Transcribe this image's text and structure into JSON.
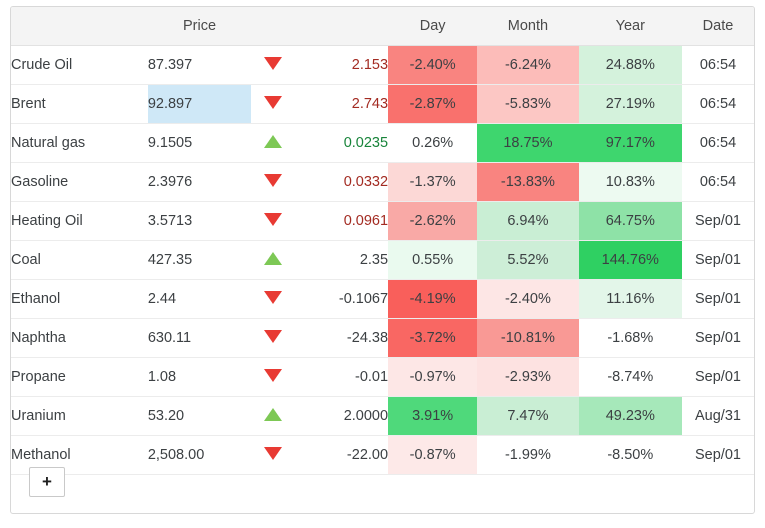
{
  "table": {
    "headers": {
      "name": "",
      "price": "Price",
      "arrow": "",
      "change": "",
      "day": "Day",
      "month": "Month",
      "year": "Year",
      "date": "Date"
    },
    "rows": [
      {
        "name": "Crude Oil",
        "price": "87.397",
        "direction": "down",
        "change": "2.153",
        "change_tone": "down",
        "day": "-2.40%",
        "day_bg": "#f98480",
        "month": "-6.24%",
        "month_bg": "#fcbcb9",
        "year": "24.88%",
        "year_bg": "#d4f2dc",
        "date": "06:54",
        "price_selected": false
      },
      {
        "name": "Brent",
        "price": "92.897",
        "direction": "down",
        "change": "2.743",
        "change_tone": "down",
        "day": "-2.87%",
        "day_bg": "#f9716d",
        "month": "-5.83%",
        "month_bg": "#fcc7c4",
        "year": "27.19%",
        "year_bg": "#d4f2dc",
        "date": "06:54",
        "price_selected": true
      },
      {
        "name": "Natural gas",
        "price": "9.1505",
        "direction": "up",
        "change": "0.0235",
        "change_tone": "up",
        "day": "0.26%",
        "day_bg": "#ffffff",
        "month": "18.75%",
        "month_bg": "#3ed66e",
        "year": "97.17%",
        "year_bg": "#3ed66e",
        "date": "06:54",
        "price_selected": false
      },
      {
        "name": "Gasoline",
        "price": "2.3976",
        "direction": "down",
        "change": "0.0332",
        "change_tone": "down",
        "day": "-1.37%",
        "day_bg": "#fcd8d6",
        "month": "-13.83%",
        "month_bg": "#f98480",
        "year": "10.83%",
        "year_bg": "#edfaf1",
        "date": "06:54",
        "price_selected": false
      },
      {
        "name": "Heating Oil",
        "price": "3.5713",
        "direction": "down",
        "change": "0.0961",
        "change_tone": "down",
        "day": "-2.62%",
        "day_bg": "#f9a9a6",
        "month": "6.94%",
        "month_bg": "#c9eed4",
        "year": "64.75%",
        "year_bg": "#8ee2a7",
        "date": "Sep/01",
        "price_selected": false
      },
      {
        "name": "Coal",
        "price": "427.35",
        "direction": "up",
        "change": "2.35",
        "change_tone": "flat",
        "day": "0.55%",
        "day_bg": "#eafaef",
        "month": "5.52%",
        "month_bg": "#cdeed7",
        "year": "144.76%",
        "year_bg": "#2fd062",
        "date": "Sep/01",
        "price_selected": false
      },
      {
        "name": "Ethanol",
        "price": "2.44",
        "direction": "down",
        "change": "-0.1067",
        "change_tone": "flat",
        "day": "-4.19%",
        "day_bg": "#f95f5b",
        "month": "-2.40%",
        "month_bg": "#fde6e5",
        "year": "11.16%",
        "year_bg": "#e3f6e9",
        "date": "Sep/01",
        "price_selected": false
      },
      {
        "name": "Naphtha",
        "price": "630.11",
        "direction": "down",
        "change": "-24.38",
        "change_tone": "flat",
        "day": "-3.72%",
        "day_bg": "#f96763",
        "month": "-10.81%",
        "month_bg": "#f99995",
        "year": "-1.68%",
        "year_bg": "#ffffff",
        "date": "Sep/01",
        "price_selected": false
      },
      {
        "name": "Propane",
        "price": "1.08",
        "direction": "down",
        "change": "-0.01",
        "change_tone": "flat",
        "day": "-0.97%",
        "day_bg": "#fde7e6",
        "month": "-2.93%",
        "month_bg": "#fde2e1",
        "year": "-8.74%",
        "year_bg": "#ffffff",
        "date": "Sep/01",
        "price_selected": false
      },
      {
        "name": "Uranium",
        "price": "53.20",
        "direction": "up",
        "change": "2.0000",
        "change_tone": "flat",
        "day": "3.91%",
        "day_bg": "#4fd97b",
        "month": "7.47%",
        "month_bg": "#c9eed4",
        "year": "49.23%",
        "year_bg": "#a6e8ba",
        "date": "Aug/31",
        "price_selected": false
      },
      {
        "name": "Methanol",
        "price": "2,508.00",
        "direction": "down",
        "change": "-22.00",
        "change_tone": "flat",
        "day": "-0.87%",
        "day_bg": "#fde9e8",
        "month": "-1.99%",
        "month_bg": "#ffffff",
        "year": "-8.50%",
        "year_bg": "#ffffff",
        "date": "Sep/01",
        "price_selected": false
      }
    ]
  },
  "footer": {
    "add_button_label": "+"
  },
  "colors": {
    "arrow_down": "#e83a33",
    "arrow_up": "#7dc855",
    "selection": "#cfe8f7",
    "header_bg": "#f4f4f4",
    "text": "#3c4043"
  }
}
